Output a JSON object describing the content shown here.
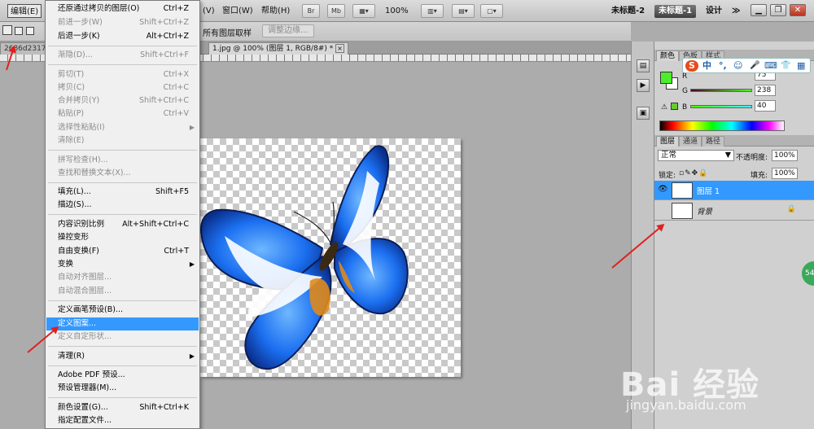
{
  "menubar": {
    "edit": "编辑(E)",
    "items": [
      "(V)",
      "窗口(W)",
      "帮助(H)"
    ],
    "zoom": "100%",
    "workspaces": [
      "未标题-2",
      "未标题-1",
      "设计"
    ],
    "more": "≫"
  },
  "options": {
    "sample_all": "所有图层取样",
    "refine_edge": "调整边缘..."
  },
  "doc": {
    "left_tab": "2686d2317c...",
    "tab": "1.jpg @ 100% (图层 1, RGB/8#) *",
    "close": "×"
  },
  "edit_menu": {
    "items": [
      {
        "label": "还原通过拷贝的图层(O)",
        "shortcut": "Ctrl+Z",
        "disabled": false
      },
      {
        "label": "前进一步(W)",
        "shortcut": "Shift+Ctrl+Z",
        "disabled": true
      },
      {
        "label": "后退一步(K)",
        "shortcut": "Alt+Ctrl+Z",
        "disabled": false
      },
      {
        "label": "渐隐(D)...",
        "shortcut": "Shift+Ctrl+F",
        "disabled": true
      },
      {
        "label": "剪切(T)",
        "shortcut": "Ctrl+X",
        "disabled": true
      },
      {
        "label": "拷贝(C)",
        "shortcut": "Ctrl+C",
        "disabled": true
      },
      {
        "label": "合并拷贝(Y)",
        "shortcut": "Shift+Ctrl+C",
        "disabled": true
      },
      {
        "label": "粘贴(P)",
        "shortcut": "Ctrl+V",
        "disabled": true
      },
      {
        "label": "选择性粘贴(I)",
        "shortcut": "",
        "disabled": true
      },
      {
        "label": "清除(E)",
        "shortcut": "",
        "disabled": true
      },
      {
        "label": "拼写检查(H)...",
        "shortcut": "",
        "disabled": true
      },
      {
        "label": "查找和替换文本(X)...",
        "shortcut": "",
        "disabled": true
      },
      {
        "label": "填充(L)...",
        "shortcut": "Shift+F5",
        "disabled": false
      },
      {
        "label": "描边(S)...",
        "shortcut": "",
        "disabled": false
      },
      {
        "label": "内容识别比例",
        "shortcut": "Alt+Shift+Ctrl+C",
        "disabled": false
      },
      {
        "label": "操控变形",
        "shortcut": "",
        "disabled": false
      },
      {
        "label": "自由变换(F)",
        "shortcut": "Ctrl+T",
        "disabled": false
      },
      {
        "label": "变换",
        "shortcut": "",
        "disabled": false
      },
      {
        "label": "自动对齐图层...",
        "shortcut": "",
        "disabled": true
      },
      {
        "label": "自动混合图层...",
        "shortcut": "",
        "disabled": true
      },
      {
        "label": "定义画笔预设(B)...",
        "shortcut": "",
        "disabled": false
      },
      {
        "label": "定义图案...",
        "shortcut": "",
        "disabled": false
      },
      {
        "label": "定义自定形状...",
        "shortcut": "",
        "disabled": true
      },
      {
        "label": "清理(R)",
        "shortcut": "",
        "disabled": false
      },
      {
        "label": "Adobe PDF 预设...",
        "shortcut": "",
        "disabled": false
      },
      {
        "label": "预设管理器(M)...",
        "shortcut": "",
        "disabled": false
      },
      {
        "label": "颜色设置(G)...",
        "shortcut": "Shift+Ctrl+K",
        "disabled": false
      },
      {
        "label": "指定配置文件...",
        "shortcut": "",
        "disabled": false
      }
    ]
  },
  "color_panel": {
    "tabs": [
      "颜色",
      "色板",
      "样式"
    ],
    "r_label": "R",
    "g_label": "G",
    "b_label": "B",
    "g_value": "238",
    "b_value": "40",
    "r_value": "75",
    "fg_color": "#4bee28"
  },
  "layers_panel": {
    "tabs": [
      "图层",
      "通道",
      "路径"
    ],
    "blend_mode": "正常",
    "opacity_label": "不透明度:",
    "opacity_value": "100%",
    "lock_label": "锁定:",
    "fill_label": "填充:",
    "fill_value": "100%",
    "layers": [
      {
        "name": "图层 1",
        "selected": true
      },
      {
        "name": "背景",
        "selected": false
      }
    ]
  },
  "ime": {
    "chars": [
      "S",
      "中",
      "°,",
      "☺",
      "🎤",
      "⌨",
      "👕",
      "▦"
    ]
  },
  "watermark": {
    "logo": "Bai 经验",
    "url": "jingyan.baidu.com"
  },
  "badge": "54"
}
